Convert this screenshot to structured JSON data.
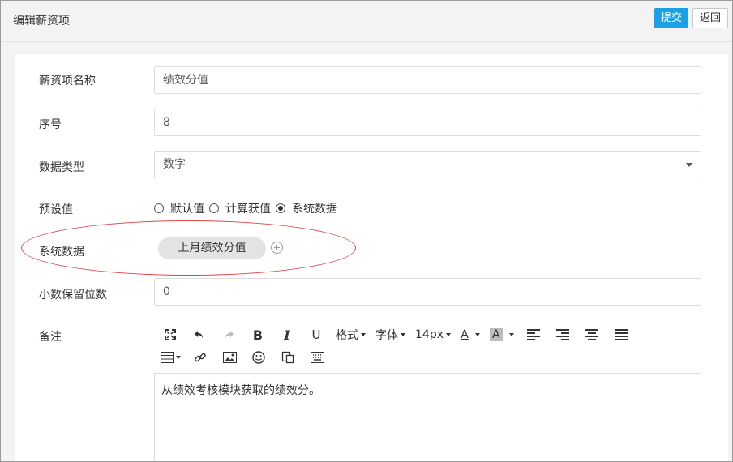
{
  "header": {
    "title": "编辑薪资项",
    "submit_label": "提交",
    "back_label": "返回"
  },
  "form": {
    "name": {
      "label": "薪资项名称",
      "value": "绩效分值"
    },
    "order": {
      "label": "序号",
      "value": "8"
    },
    "data_type": {
      "label": "数据类型",
      "selected": "数字"
    },
    "preset": {
      "label": "预设值",
      "options": [
        "默认值",
        "计算获值",
        "系统数据"
      ],
      "selected": "系统数据"
    },
    "system_data": {
      "label": "系统数据",
      "chip": "上月绩效分值"
    },
    "decimals": {
      "label": "小数保留位数",
      "value": "0"
    },
    "remark": {
      "label": "备注",
      "toolbar": {
        "format_label": "格式",
        "font_label": "字体",
        "size_label": "14px",
        "color_a": "A",
        "bgcolor_a": "A"
      },
      "content": "从绩效考核模块获取的绩效分。"
    }
  },
  "colors": {
    "accent": "#1aa0e6",
    "highlight": "#e0464a"
  }
}
